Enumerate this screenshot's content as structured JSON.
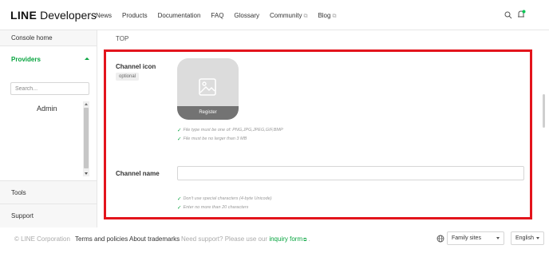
{
  "header": {
    "logo_line": "LINE",
    "logo_developers": "Developers",
    "nav": [
      {
        "label": "News"
      },
      {
        "label": "Products"
      },
      {
        "label": "Documentation"
      },
      {
        "label": "FAQ"
      },
      {
        "label": "Glossary"
      },
      {
        "label": "Community"
      },
      {
        "label": "Blog"
      }
    ],
    "search_icon": "search-icon",
    "bell_icon": "bell-icon"
  },
  "sidebar": {
    "console_home": "Console home",
    "providers": "Providers",
    "search_placeholder": "Search...",
    "provider_items": [
      {
        "label": "Admin"
      }
    ],
    "tools": "Tools",
    "support": "Support"
  },
  "main": {
    "breadcrumb": "TOP",
    "channel_icon": {
      "label": "Channel icon",
      "optional_badge": "optional",
      "register_label": "Register",
      "hints": [
        "File type must be one of: PNG,JPG,JPEG,GIF,BMP",
        "File must be no larger than 3 MB"
      ]
    },
    "channel_name": {
      "label": "Channel name",
      "value": "",
      "hints": [
        "Don't use special characters (4-byte Unicode)",
        "Enter no more than 20 characters"
      ]
    }
  },
  "footer": {
    "copyright": "© LINE Corporation",
    "terms": "Terms and policies",
    "trademarks": "About trademarks",
    "support_prefix": "Need support? Please use our",
    "inquiry": "inquiry form",
    "support_suffix": ".",
    "family_sites": "Family sites",
    "language": "English"
  },
  "colors": {
    "accent_green": "#06a43e",
    "highlight_red": "#e3141c"
  }
}
